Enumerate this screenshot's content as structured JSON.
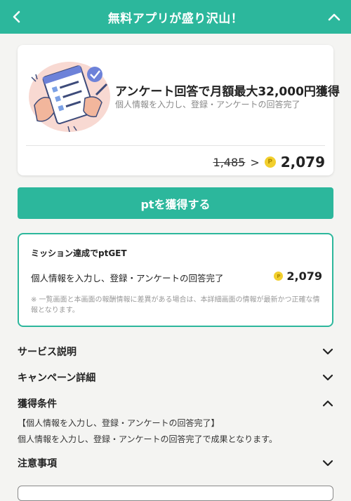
{
  "header": {
    "title": "無料アプリが盛り沢山！",
    "back_icon": "chevron-left-icon",
    "collapse_icon": "chevron-up-icon",
    "bg_color": "#2cb79c"
  },
  "offer": {
    "title": "アンケート回答で月額最大32,000円獲得",
    "subtitle": "個人情報を入力し、登録・アンケートの回答完了",
    "old_points": "1,485",
    "arrow": ">",
    "coin_letter": "P",
    "new_points": "2,079"
  },
  "cta": {
    "label": "ptを獲得する",
    "color": "#2cb79c"
  },
  "mission": {
    "title": "ミッション達成でptGET",
    "description": "個人情報を入力し、登録・アンケートの回答完了",
    "points": "2,079",
    "note": "※ 一覧画面と本画面の報酬情報に差異がある場合は、本詳細画面の情報が最新かつ正確な情報となります。"
  },
  "sections": {
    "service": {
      "label": "サービス説明",
      "state": "collapsed"
    },
    "campaign": {
      "label": "キャンペーン詳細",
      "state": "collapsed"
    },
    "conditions": {
      "label": "獲得条件",
      "state": "expanded",
      "line1": "【個人情報を入力し、登録・アンケートの回答完了】",
      "line2": "個人情報を入力し、登録・アンケートの回答完了で成果となります。"
    },
    "notes": {
      "label": "注意事項",
      "state": "collapsed"
    }
  }
}
